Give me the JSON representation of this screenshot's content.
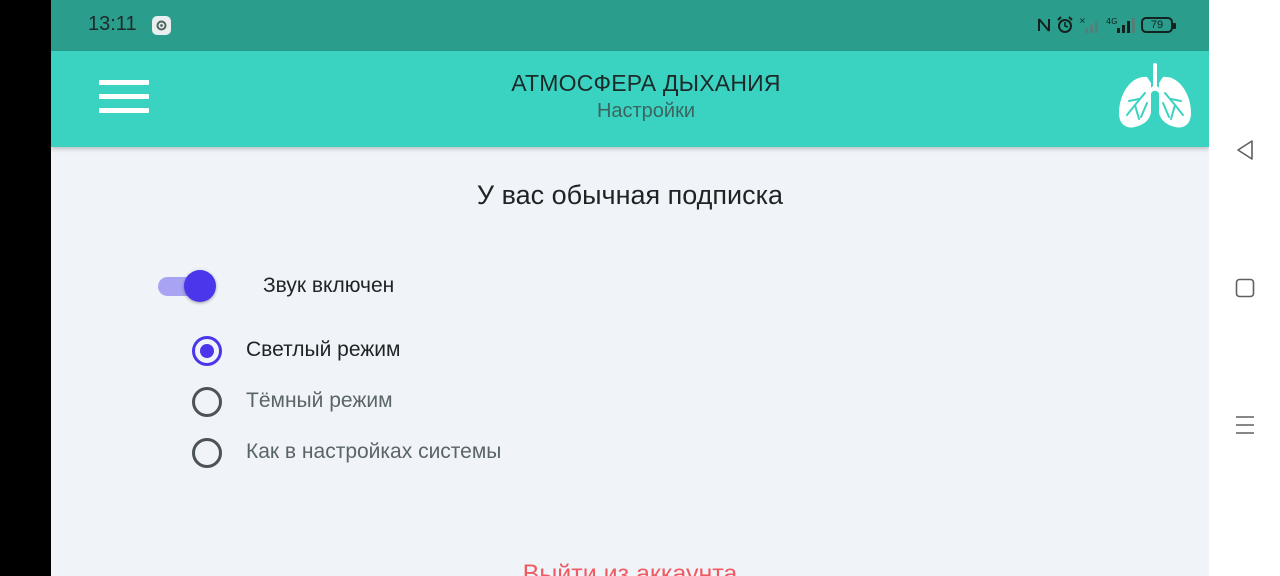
{
  "status_bar": {
    "time": "13:11",
    "battery": "79",
    "network": "4G"
  },
  "app_bar": {
    "title": "АТМОСФЕРА ДЫХАНИЯ",
    "subtitle": "Настройки"
  },
  "settings": {
    "subscription_text": "У вас обычная подписка",
    "sound_label": "Звук включен",
    "sound_enabled": true,
    "theme_options": [
      {
        "label": "Светлый режим",
        "selected": true
      },
      {
        "label": "Тёмный режим",
        "selected": false
      },
      {
        "label": "Как в настройках системы",
        "selected": false
      }
    ],
    "logout_label": "Выйти из аккаунта"
  },
  "colors": {
    "status_bar": "#2a9d8c",
    "app_bar": "#3ad3c1",
    "accent": "#4a37ec",
    "background": "#f0f3f8",
    "logout": "#f05b63"
  },
  "icons": {
    "menu": "hamburger-menu-icon",
    "logo": "lungs-icon",
    "system_nav": [
      "back-icon",
      "home-icon",
      "recents-icon"
    ]
  }
}
